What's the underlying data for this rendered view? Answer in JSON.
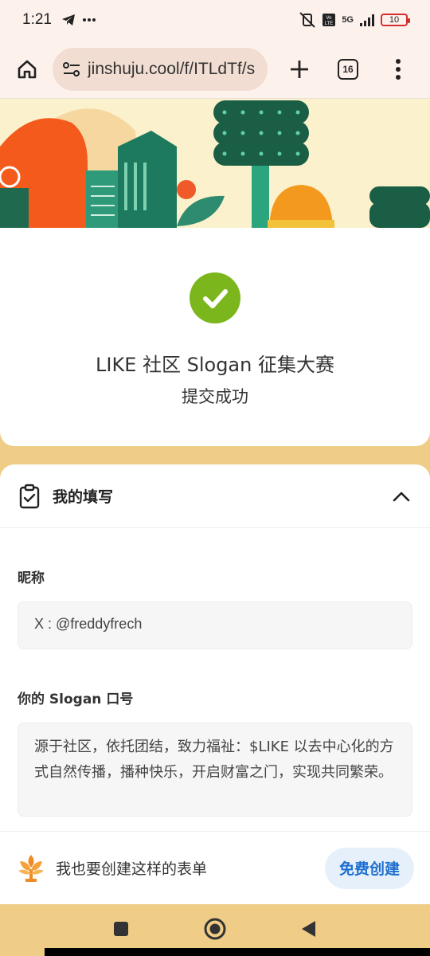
{
  "status_bar": {
    "time": "1:21",
    "network": "5G",
    "battery": "10"
  },
  "browser": {
    "url": "jinshuju.cool/f/ITLdTf/s",
    "tab_count": "16"
  },
  "success": {
    "title": "LIKE 社区 Slogan 征集大赛",
    "subtitle": "提交成功",
    "accent_color": "#7cb61d"
  },
  "answers": {
    "section_title": "我的填写",
    "fields": [
      {
        "label": "昵称",
        "value": "X : @freddyfrech"
      },
      {
        "label": "你的 Slogan 口号",
        "value": "源于社区，依托团结，致力福祉：$LIKE 以去中心化的方式自然传播，播种快乐，开启财富之门，实现共同繁荣。"
      }
    ]
  },
  "cta": {
    "text": "我也要创建这样的表单",
    "button_label": "免费创建",
    "button_color": "#1e6fd0"
  },
  "icons": [
    "telegram-icon",
    "more-icon",
    "mute-icon",
    "volte-icon",
    "signal-icon",
    "battery-icon",
    "home-icon",
    "site-settings-icon",
    "plus-icon",
    "tab-switcher-icon",
    "overflow-menu-icon",
    "check-icon",
    "clipboard-check-icon",
    "chevron-up-icon",
    "jinshuju-logo-icon",
    "recents-icon",
    "home-circle-icon",
    "back-icon"
  ]
}
